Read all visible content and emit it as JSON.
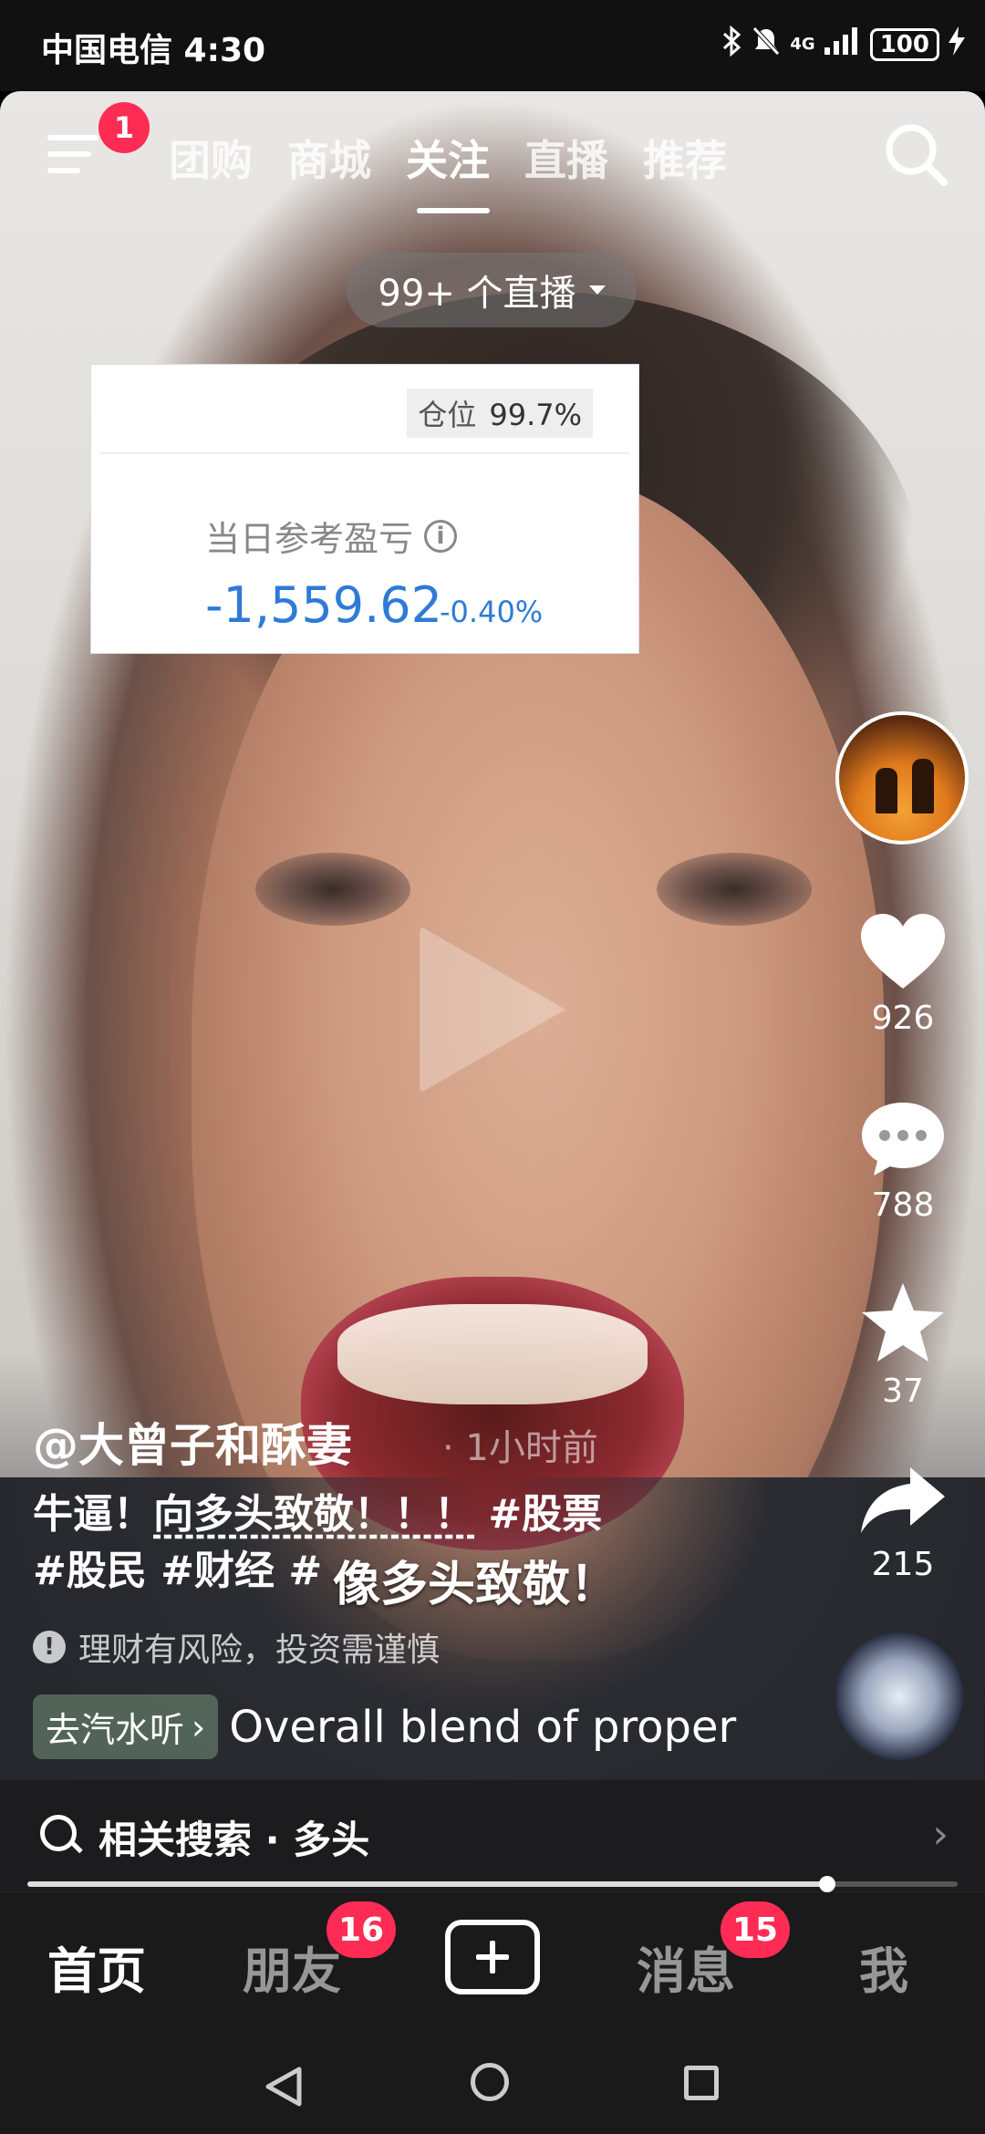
{
  "status_bar": {
    "carrier_time": "中国电信 4:30",
    "network": "4G",
    "battery": "100"
  },
  "top_nav": {
    "menu_badge": "1",
    "tabs": [
      "团购",
      "商城",
      "关注",
      "直播",
      "推荐"
    ],
    "active_tab_index": 2
  },
  "live_pill": "99+ 个直播",
  "stock_card": {
    "position_label": "仓位",
    "position_value": "99.7%",
    "pnl_label": "当日参考盈亏",
    "info_icon_text": "i",
    "pnl_value": "-1,559.62",
    "pnl_pct": "-0.40%"
  },
  "rail": {
    "likes": "926",
    "comments": "788",
    "favorites": "37",
    "shares": "215"
  },
  "post": {
    "author": "@大曾子和酥妻",
    "time": "· 1小时前",
    "caption_line1_a": "牛逼！",
    "caption_line1_b": "向多头致敬！！！",
    "caption_line1_c": " #股票",
    "caption_line2": "#股民 #财经 #",
    "overlay_text": "像多头致敬！",
    "risk_text": "理财有风险，投资需谨慎",
    "music_chip": "去汽水听",
    "music_title": "Overall blend of proper"
  },
  "related_search": "相关搜索 · 多头",
  "progress": 0.86,
  "bottom_nav": {
    "home": "首页",
    "friends": "朋友",
    "friends_badge": "16",
    "messages": "消息",
    "messages_badge": "15",
    "me": "我"
  }
}
